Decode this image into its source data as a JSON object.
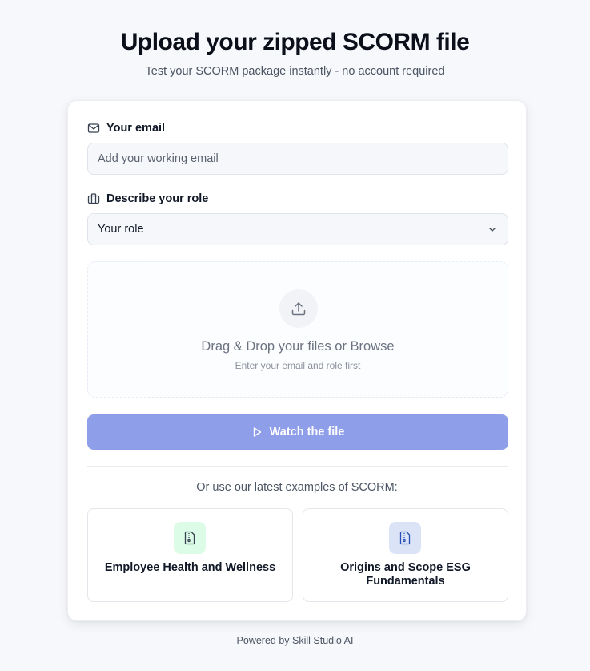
{
  "header": {
    "title": "Upload your zipped SCORM file",
    "subtitle": "Test your SCORM package instantly - no account required"
  },
  "form": {
    "email_label": "Your email",
    "email_placeholder": "Add your working email",
    "email_value": "",
    "role_label": "Describe your role",
    "role_selected": "Your role"
  },
  "dropzone": {
    "title": "Drag & Drop your files or Browse",
    "hint": "Enter your email and role first"
  },
  "actions": {
    "watch_label": "Watch the file"
  },
  "examples": {
    "heading": "Or use our latest examples of SCORM:",
    "items": [
      {
        "label": "Employee Health and Wellness",
        "icon": "file-archive-icon",
        "icon_bg": "#dcfce7",
        "icon_color": "#16a34a"
      },
      {
        "label": "Origins and Scope ESG Fundamentals",
        "icon": "file-archive-icon",
        "icon_bg": "#dbe4f7",
        "icon_color": "#2563eb"
      }
    ]
  },
  "footer": {
    "text": "Powered by Skill Studio AI"
  },
  "colors": {
    "accent": "#8f9ee8",
    "background": "#f7f8fb"
  }
}
